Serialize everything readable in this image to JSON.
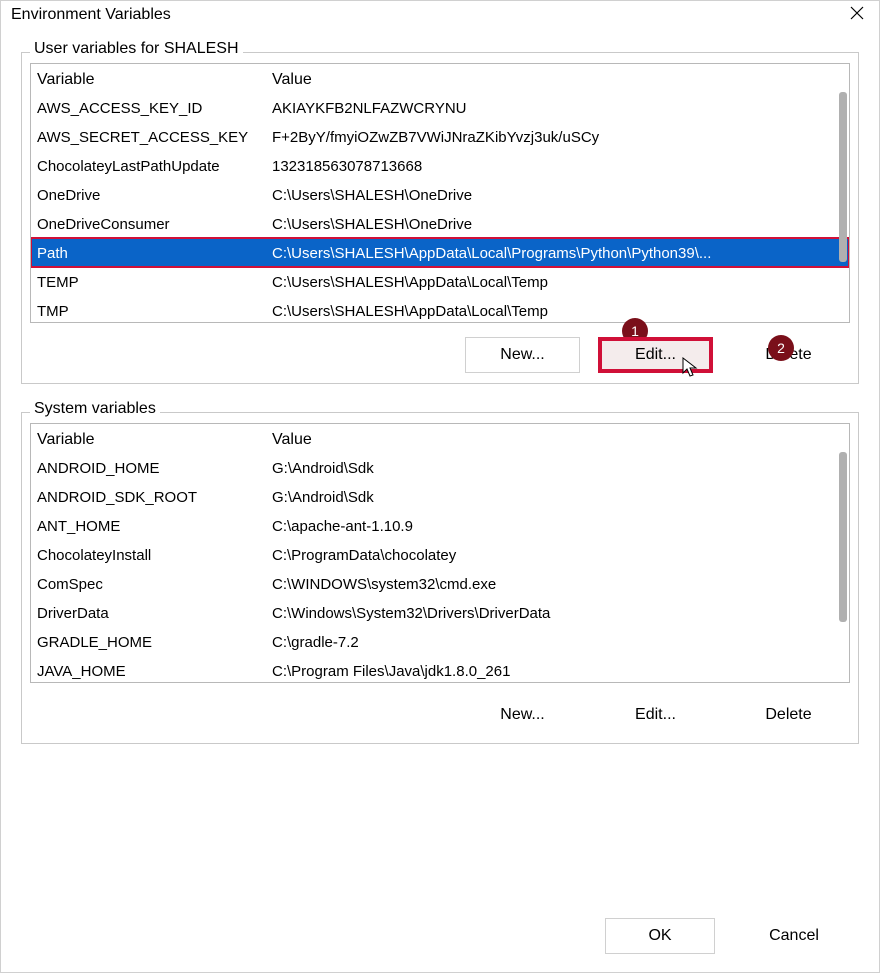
{
  "title": "Environment Variables",
  "user_group_label": "User variables for SHALESH",
  "system_group_label": "System variables",
  "columns": {
    "variable": "Variable",
    "value": "Value"
  },
  "user_vars": [
    {
      "variable": "AWS_ACCESS_KEY_ID",
      "value": "AKIAYKFB2NLFAZWCRYNU",
      "selected": false
    },
    {
      "variable": "AWS_SECRET_ACCESS_KEY",
      "value": "F+2ByY/fmyiOZwZB7VWiJNraZKibYvzj3uk/uSCy",
      "selected": false
    },
    {
      "variable": "ChocolateyLastPathUpdate",
      "value": "132318563078713668",
      "selected": false
    },
    {
      "variable": "OneDrive",
      "value": "C:\\Users\\SHALESH\\OneDrive",
      "selected": false
    },
    {
      "variable": "OneDriveConsumer",
      "value": "C:\\Users\\SHALESH\\OneDrive",
      "selected": false
    },
    {
      "variable": "Path",
      "value": "C:\\Users\\SHALESH\\AppData\\Local\\Programs\\Python\\Python39\\...",
      "selected": true
    },
    {
      "variable": "TEMP",
      "value": "C:\\Users\\SHALESH\\AppData\\Local\\Temp",
      "selected": false
    },
    {
      "variable": "TMP",
      "value": "C:\\Users\\SHALESH\\AppData\\Local\\Temp",
      "selected": false
    }
  ],
  "system_vars": [
    {
      "variable": "ANDROID_HOME",
      "value": "G:\\Android\\Sdk"
    },
    {
      "variable": "ANDROID_SDK_ROOT",
      "value": "G:\\Android\\Sdk"
    },
    {
      "variable": "ANT_HOME",
      "value": "C:\\apache-ant-1.10.9"
    },
    {
      "variable": "ChocolateyInstall",
      "value": "C:\\ProgramData\\chocolatey"
    },
    {
      "variable": "ComSpec",
      "value": "C:\\WINDOWS\\system32\\cmd.exe"
    },
    {
      "variable": "DriverData",
      "value": "C:\\Windows\\System32\\Drivers\\DriverData"
    },
    {
      "variable": "GRADLE_HOME",
      "value": "C:\\gradle-7.2"
    },
    {
      "variable": "JAVA_HOME",
      "value": "C:\\Program Files\\Java\\jdk1.8.0_261"
    }
  ],
  "buttons": {
    "new": "New...",
    "edit": "Edit...",
    "delete": "Delete",
    "ok": "OK",
    "cancel": "Cancel"
  },
  "annotations": {
    "badge1": "1",
    "badge2": "2"
  }
}
